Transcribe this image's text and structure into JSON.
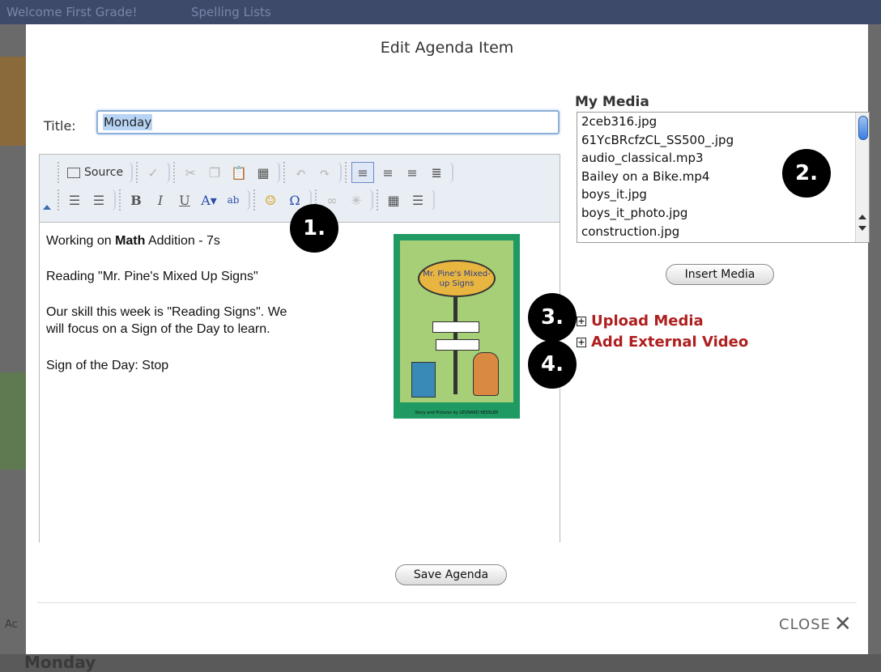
{
  "background": {
    "tabs": [
      "Welcome First Grade!",
      "Spelling Lists"
    ],
    "bottom_heading": "Monday",
    "side_text": "Ac"
  },
  "modal": {
    "title": "Edit Agenda Item",
    "title_label": "Title:",
    "title_value": "Monday",
    "toolbar": {
      "source_label": "Source"
    },
    "content": {
      "line1_pre": "Working on ",
      "line1_bold": "Math",
      "line1_post": " Addition - 7s",
      "line2": "Reading \"Mr. Pine's Mixed Up Signs\"",
      "line3a": "Our skill this week is \"Reading Signs\". We",
      "line3b": "will focus on a Sign of the Day to learn.",
      "line4": "Sign of the Day: Stop",
      "book_title": "Mr. Pine's Mixed-up Signs",
      "book_caption": "Story and Pictures by LEONARD KESSLER"
    },
    "media": {
      "label": "My Media",
      "items": [
        "2ceb316.jpg",
        "61YcBRcfzCL_SS500_.jpg",
        "audio_classical.mp3",
        "Bailey on a Bike.mp4",
        "boys_it.jpg",
        "boys_it_photo.jpg",
        "construction.jpg"
      ],
      "insert_label": "Insert Media"
    },
    "links": {
      "upload_plus": "+",
      "upload": "Upload Media",
      "video_plus": "+",
      "video": "Add External Video"
    },
    "save_label": "Save Agenda",
    "close_label": "CLOSE",
    "close_icon": "✕"
  },
  "badges": [
    "1.",
    "2.",
    "3.",
    "4."
  ]
}
